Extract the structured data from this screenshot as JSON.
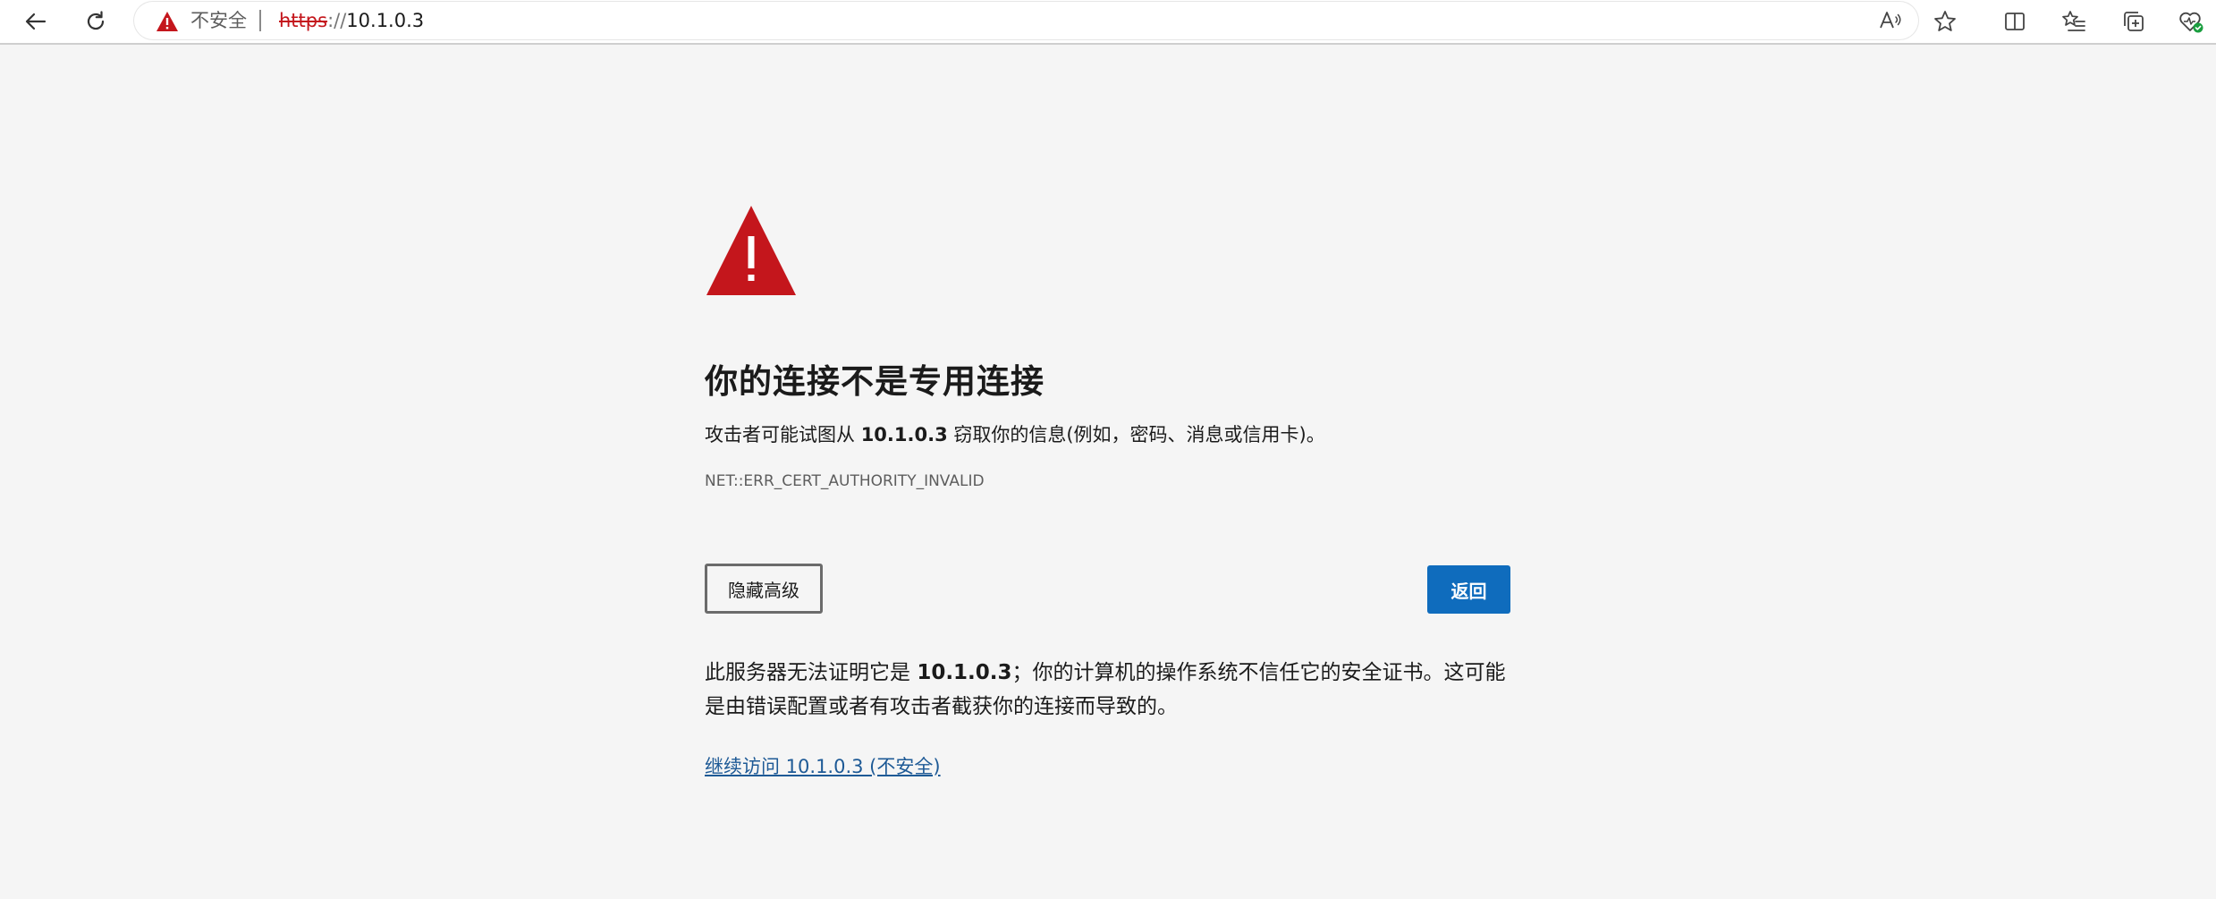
{
  "browser": {
    "address_bar": {
      "security_label": "不安全",
      "url_scheme": "https",
      "url_separator": "://",
      "url_host": "10.1.0.3"
    },
    "toolbar_icons": [
      "back-arrow-icon",
      "refresh-icon",
      "read-aloud-icon",
      "favorite-star-icon",
      "split-screen-icon",
      "favorites-list-icon",
      "collections-icon",
      "browser-essentials-icon"
    ],
    "colors": {
      "warning_red": "#c4161c",
      "accent_blue": "#0f6cbd",
      "link_blue": "#1e5a96",
      "essentials_green": "#1a9e3f"
    }
  },
  "page": {
    "title": "你的连接不是专用连接",
    "description_prefix": "攻击者可能试图从 ",
    "description_host": "10.1.0.3",
    "description_suffix": " 窃取你的信息(例如，密码、消息或信用卡)。",
    "error_code": "NET::ERR_CERT_AUTHORITY_INVALID",
    "advanced_button_label": "隐藏高级",
    "back_button_label": "返回",
    "details_prefix": "此服务器无法证明它是 ",
    "details_host": "10.1.0.3",
    "details_suffix": "；你的计算机的操作系统不信任它的安全证书。这可能是由错误配置或者有攻击者截获你的连接而导致的。",
    "proceed_link": "继续访问 10.1.0.3 (不安全)"
  }
}
